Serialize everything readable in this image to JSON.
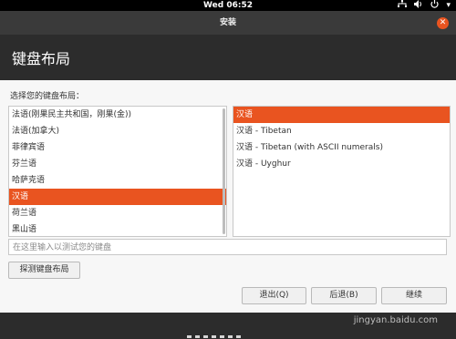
{
  "topbar": {
    "time": "Wed 06:52",
    "icons": [
      "network-icon",
      "volume-icon",
      "power-icon"
    ]
  },
  "window": {
    "title": "安装",
    "close_glyph": "✕"
  },
  "page_title": "键盘布局",
  "prompt": "选择您的键盘布局：",
  "layouts": [
    {
      "label": "法语(刚果民主共和国，刚果(金))",
      "selected": false
    },
    {
      "label": "法语(加拿大)",
      "selected": false
    },
    {
      "label": "菲律宾语",
      "selected": false
    },
    {
      "label": "芬兰语",
      "selected": false
    },
    {
      "label": "哈萨克语",
      "selected": false
    },
    {
      "label": "汉语",
      "selected": true
    },
    {
      "label": "荷兰语",
      "selected": false
    },
    {
      "label": "黑山语",
      "selected": false
    }
  ],
  "variants": [
    {
      "label": "汉语",
      "selected": true
    },
    {
      "label": "汉语 - Tibetan",
      "selected": false
    },
    {
      "label": "汉语 - Tibetan (with ASCII numerals)",
      "selected": false
    },
    {
      "label": "汉语 - Uyghur",
      "selected": false
    }
  ],
  "test_input": {
    "placeholder": "在这里输入以测试您的键盘",
    "value": ""
  },
  "buttons": {
    "detect": "探测键盘布局",
    "quit": "退出(Q)",
    "back": "后退(B)",
    "continue": "继续"
  },
  "watermark": "jingyan.baidu.com",
  "colors": {
    "accent": "#e95420"
  }
}
